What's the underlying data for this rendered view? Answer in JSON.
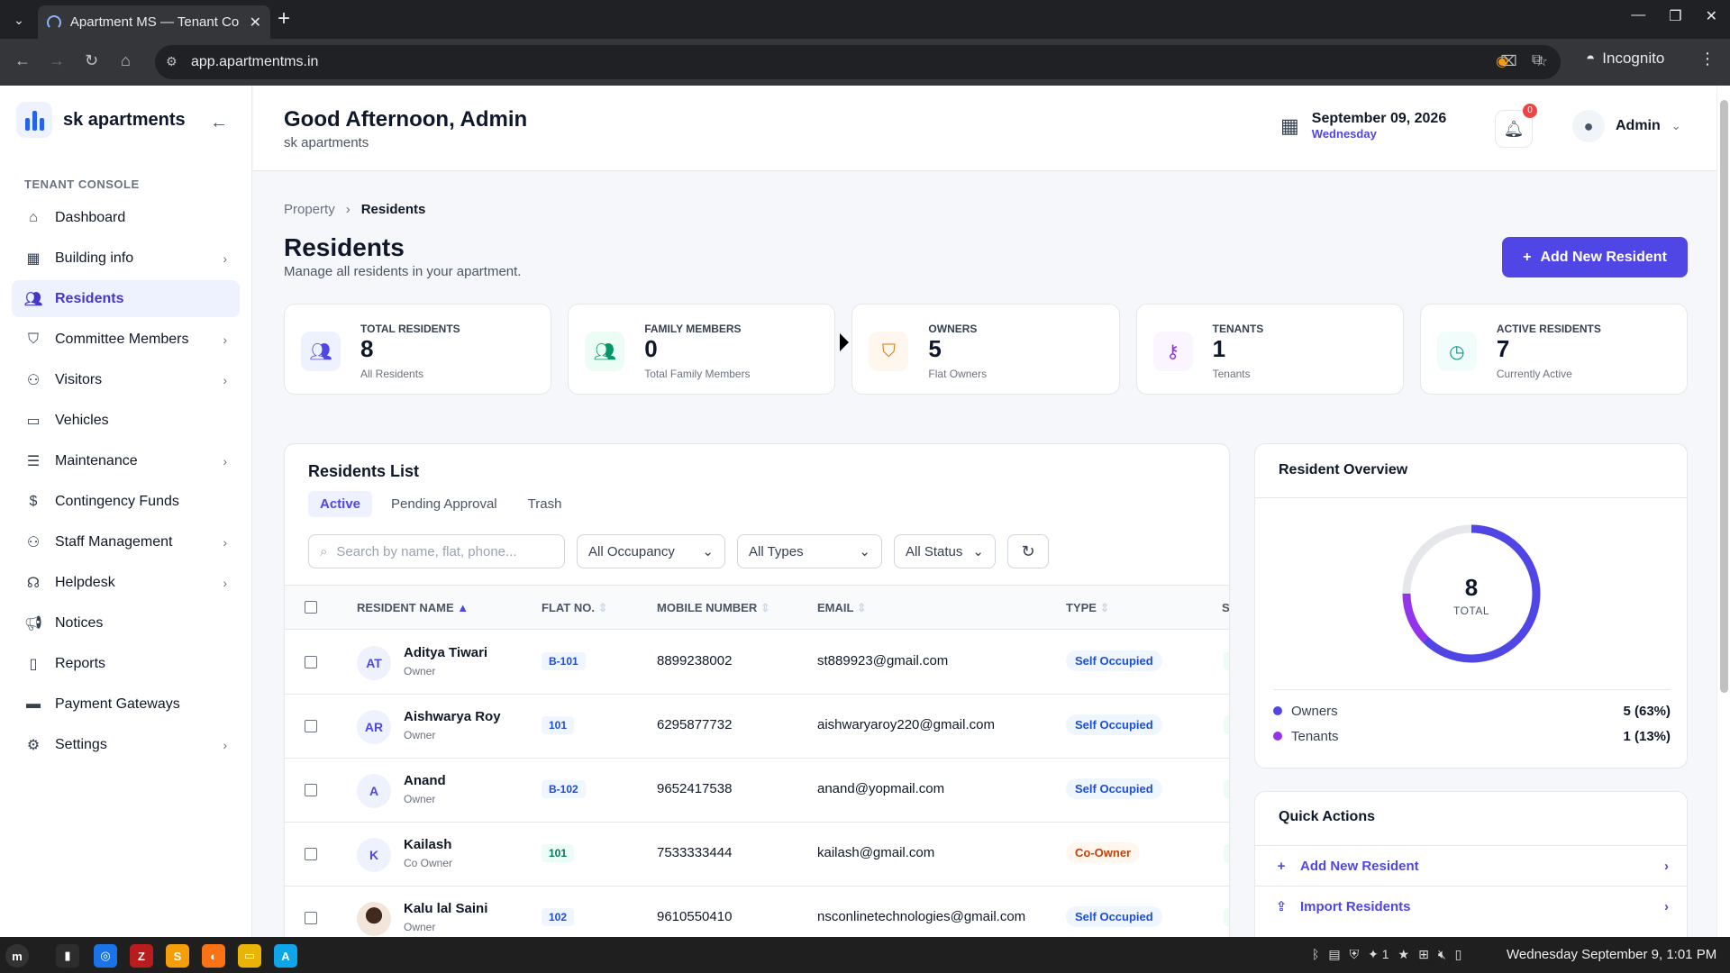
{
  "browser": {
    "tab_title": "Apartment MS — Tenant Co",
    "url": "app.apartmentms.in",
    "incognito_label": "Incognito"
  },
  "brand": {
    "name": "sk apartments"
  },
  "sidebar": {
    "section_label": "TENANT CONSOLE",
    "items": [
      {
        "label": "Dashboard",
        "icon": "home-icon",
        "has_children": false
      },
      {
        "label": "Building info",
        "icon": "grid-icon",
        "has_children": true
      },
      {
        "label": "Residents",
        "icon": "users-icon",
        "has_children": false,
        "active": true
      },
      {
        "label": "Committee Members",
        "icon": "shield-icon",
        "has_children": true
      },
      {
        "label": "Visitors",
        "icon": "user-plus-icon",
        "has_children": true
      },
      {
        "label": "Vehicles",
        "icon": "car-icon",
        "has_children": false
      },
      {
        "label": "Maintenance",
        "icon": "server-icon",
        "has_children": true
      },
      {
        "label": "Contingency Funds",
        "icon": "dollar-icon",
        "has_children": false
      },
      {
        "label": "Staff Management",
        "icon": "staff-icon",
        "has_children": true
      },
      {
        "label": "Helpdesk",
        "icon": "headset-icon",
        "has_children": true
      },
      {
        "label": "Notices",
        "icon": "megaphone-icon",
        "has_children": false
      },
      {
        "label": "Reports",
        "icon": "file-icon",
        "has_children": false
      },
      {
        "label": "Payment Gateways",
        "icon": "card-icon",
        "has_children": false
      },
      {
        "label": "Settings",
        "icon": "gear-icon",
        "has_children": true
      }
    ]
  },
  "header": {
    "greeting": "Good Afternoon, Admin",
    "subtitle": "sk apartments",
    "date": "September 09, 2026",
    "weekday": "Wednesday",
    "notification_count": "0",
    "user_name": "Admin"
  },
  "breadcrumb": {
    "parent": "Property",
    "current": "Residents"
  },
  "page": {
    "title": "Residents",
    "subtitle": "Manage all residents in your apartment.",
    "add_button": "Add New Resident"
  },
  "stats": [
    {
      "label": "TOTAL RESIDENTS",
      "value": "8",
      "hint": "All Residents",
      "icon": "users-icon",
      "color": "#4f46e5",
      "bg": "#eef2ff"
    },
    {
      "label": "FAMILY MEMBERS",
      "value": "0",
      "hint": "Total Family Members",
      "icon": "users-icon",
      "color": "#059669",
      "bg": "#ecfdf5"
    },
    {
      "label": "OWNERS",
      "value": "5",
      "hint": "Flat Owners",
      "icon": "shield-icon",
      "color": "#d97706",
      "bg": "#fff7ed"
    },
    {
      "label": "TENANTS",
      "value": "1",
      "hint": "Tenants",
      "icon": "key-icon",
      "color": "#9333ea",
      "bg": "#faf5ff"
    },
    {
      "label": "ACTIVE RESIDENTS",
      "value": "7",
      "hint": "Currently Active",
      "icon": "clock-icon",
      "color": "#0d9488",
      "bg": "#f0fdfa"
    }
  ],
  "list": {
    "title": "Residents List",
    "tabs": [
      "Active",
      "Pending Approval",
      "Trash"
    ],
    "active_tab": "Active",
    "search_placeholder": "Search by name, flat, phone...",
    "filter_occupancy": "All Occupancy",
    "filter_types": "All Types",
    "filter_status": "All Status",
    "columns": [
      "RESIDENT NAME",
      "FLAT NO.",
      "MOBILE NUMBER",
      "EMAIL",
      "TYPE",
      "S"
    ],
    "rows": [
      {
        "initials": "AT",
        "name": "Aditya Tiwari",
        "role": "Owner",
        "flat": "B-101",
        "flat_color": "blue",
        "mobile": "8899238002",
        "email": "st889923@gmail.com",
        "type": "Self Occupied",
        "type_style": "self"
      },
      {
        "initials": "AR",
        "name": "Aishwarya Roy",
        "role": "Owner",
        "flat": "101",
        "flat_color": "blue",
        "mobile": "6295877732",
        "email": "aishwaryaroy220@gmail.com",
        "type": "Self Occupied",
        "type_style": "self"
      },
      {
        "initials": "A",
        "name": "Anand",
        "role": "Owner",
        "flat": "B-102",
        "flat_color": "blue",
        "mobile": "9652417538",
        "email": "anand@yopmail.com",
        "type": "Self Occupied",
        "type_style": "self"
      },
      {
        "initials": "K",
        "name": "Kailash",
        "role": "Co Owner",
        "flat": "101",
        "flat_color": "green",
        "mobile": "7533333444",
        "email": "kailash@gmail.com",
        "type": "Co-Owner",
        "type_style": "co"
      },
      {
        "initials": "",
        "name": "Kalu lal Saini",
        "role": "Owner",
        "flat": "102",
        "flat_color": "blue",
        "mobile": "9610550410",
        "email": "nsconlinetechnologies@gmail.com",
        "type": "Self Occupied",
        "type_style": "self",
        "photo": true
      }
    ]
  },
  "overview": {
    "title": "Resident Overview",
    "total": "8",
    "total_label": "TOTAL",
    "legend": [
      {
        "label": "Owners",
        "value": "5 (63%)",
        "color": "#4f46e5"
      },
      {
        "label": "Tenants",
        "value": "1 (13%)",
        "color": "#9333ea"
      }
    ],
    "chart_data": {
      "type": "pie",
      "categories": [
        "Owners",
        "Tenants"
      ],
      "values": [
        5,
        1
      ],
      "total": 8
    }
  },
  "quick_actions": {
    "title": "Quick Actions",
    "items": [
      {
        "label": "Add New Resident",
        "icon": "plus-icon"
      },
      {
        "label": "Import Residents",
        "icon": "upload-icon"
      }
    ]
  },
  "taskbar": {
    "clock": "Wednesday September 9, 1:01 PM"
  }
}
